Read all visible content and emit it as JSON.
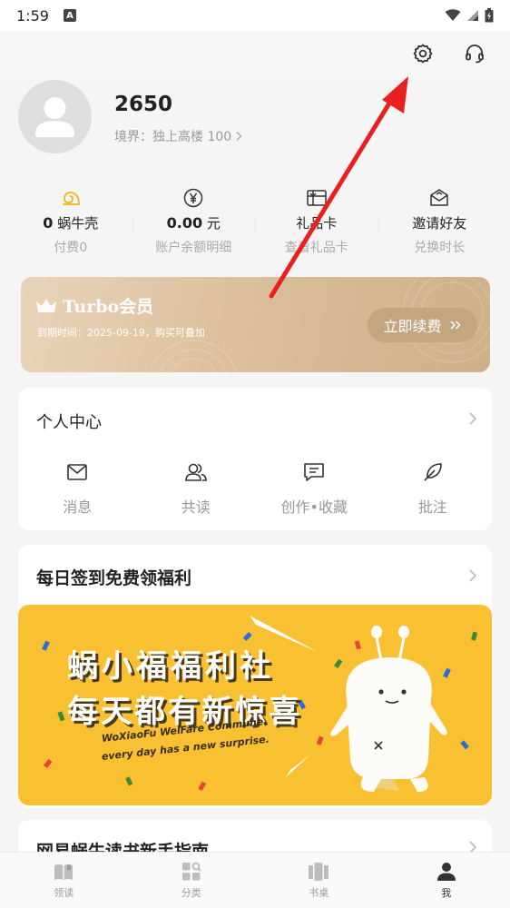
{
  "status_bar": {
    "time": "1:59"
  },
  "header": {
    "settings_icon": "gear-icon",
    "service_icon": "headset-icon"
  },
  "profile": {
    "username": "2650",
    "realm": "境界：独上高楼 100"
  },
  "stats": [
    {
      "value": "0",
      "unit": "蜗牛壳",
      "sub": "付费0",
      "icon": "snail-shell-icon"
    },
    {
      "value": "0.00",
      "unit": "元",
      "sub": "账户余额明细",
      "icon": "yen-icon"
    },
    {
      "value": "",
      "unit": "礼品卡",
      "sub": "查看礼品卡",
      "icon": "gift-card-icon"
    },
    {
      "value": "",
      "unit": "邀请好友",
      "sub": "兑换时长",
      "icon": "invite-icon"
    }
  ],
  "turbo": {
    "title": "Turbo会员",
    "expire": "到期时间：2025-09-19，购买可叠加",
    "button": "立即续费"
  },
  "personal_center": {
    "title": "个人中心",
    "items": [
      {
        "label": "消息",
        "icon": "mail-icon"
      },
      {
        "label": "共读",
        "icon": "people-icon"
      },
      {
        "label": "创作•收藏",
        "icon": "chat-edit-icon"
      },
      {
        "label": "批注",
        "icon": "feather-icon"
      }
    ]
  },
  "checkin": {
    "title": "每日签到免费领福利",
    "banner_line1": "蜗小福福利社",
    "banner_line2": "每天都有新惊喜",
    "banner_en1": "WoXiaoFu WelFare Commune",
    "banner_en2": "every day has a new surprise."
  },
  "guide": {
    "title": "网易蜗牛读书新手指南"
  },
  "bottom_nav": [
    {
      "label": "领读",
      "icon": "book-icon"
    },
    {
      "label": "分类",
      "icon": "category-icon"
    },
    {
      "label": "书桌",
      "icon": "bookshelf-icon"
    },
    {
      "label": "我",
      "icon": "user-icon"
    }
  ],
  "colors": {
    "arrow": "#e8211e",
    "accent_gold": "#c5a57f",
    "banner_yellow": "#f9c132"
  }
}
